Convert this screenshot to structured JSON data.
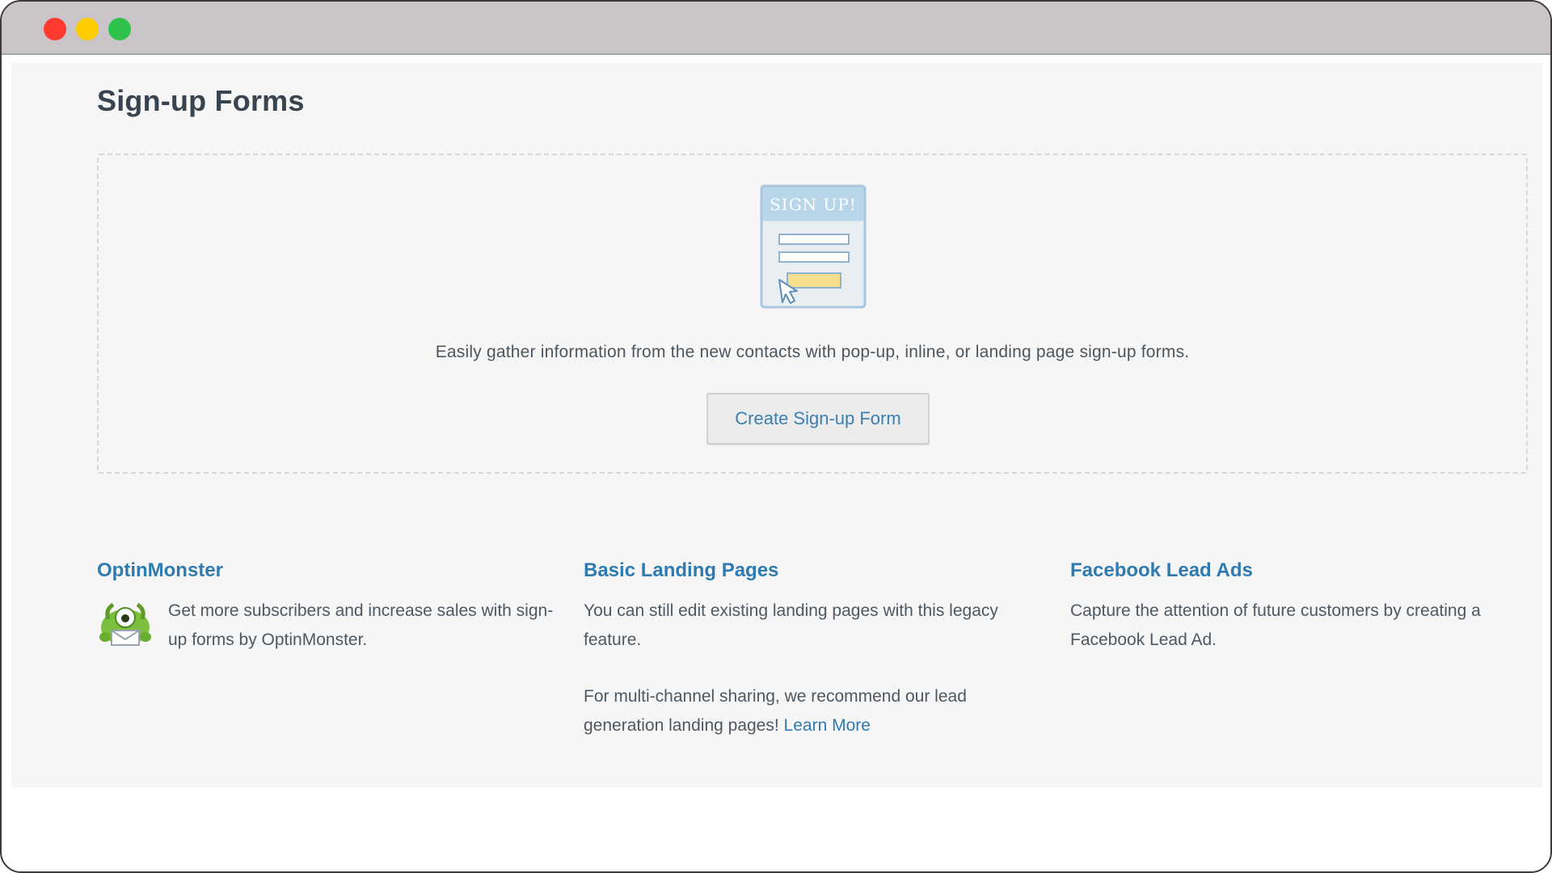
{
  "page": {
    "title": "Sign-up Forms"
  },
  "empty_state": {
    "illustration_label": "SIGN UP!",
    "description": "Easily gather information from the new contacts with pop-up, inline, or landing page sign-up forms.",
    "create_button_label": "Create Sign-up Form"
  },
  "features": {
    "optinmonster": {
      "title": "OptinMonster",
      "text": "Get more subscribers and increase sales with sign-up forms by OptinMonster.",
      "icon": "optinmonster-mascot-icon"
    },
    "landing_pages": {
      "title": "Basic Landing Pages",
      "text_1": "You can still edit existing landing pages with this legacy feature.",
      "text_2": "For multi-channel sharing, we recommend our lead generation landing pages!",
      "link_label": "Learn More"
    },
    "facebook": {
      "title": "Facebook Lead Ads",
      "text": "Capture the attention of future customers by creating a Facebook Lead Ad."
    }
  },
  "colors": {
    "accent": "#2e7bb2",
    "title_text": "#38444f",
    "content_bg": "#f6f6f7"
  }
}
